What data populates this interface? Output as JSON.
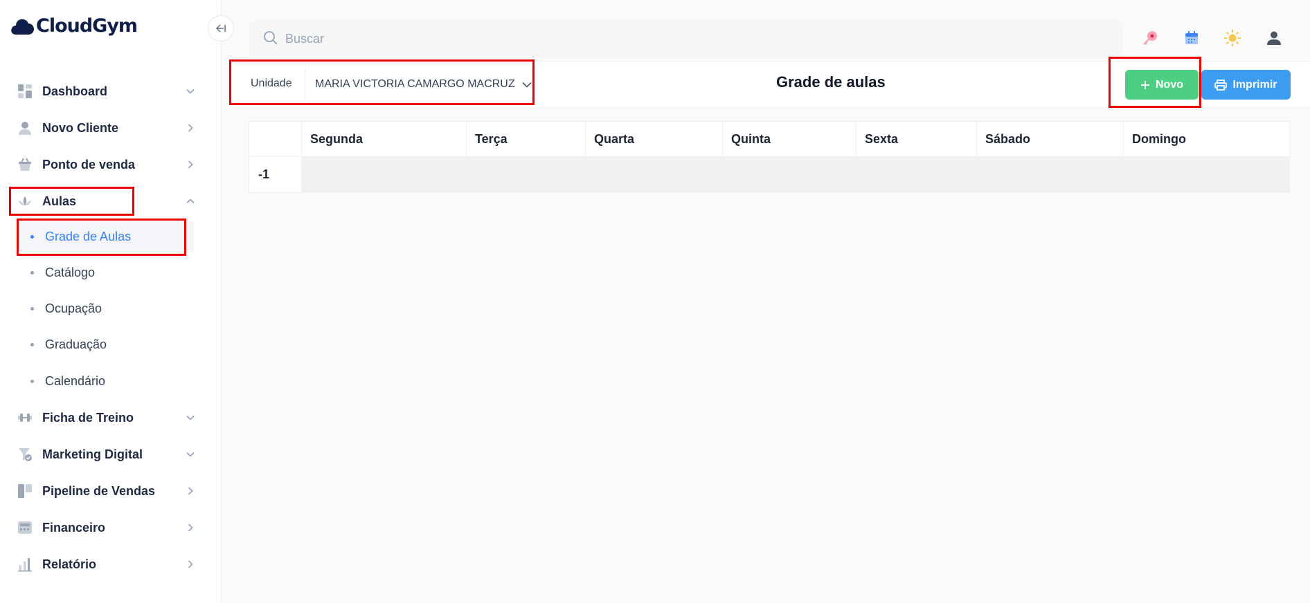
{
  "app": {
    "brand": "CloudGym",
    "brand_part1": "Cloud",
    "brand_part2": "Gym"
  },
  "colors": {
    "accent_blue": "#3b82f6",
    "new_button": "#4ccf80",
    "print_button": "#3b9cf2",
    "highlight": "#ee0000",
    "brand_navy": "#0f1e4a"
  },
  "sidebar": {
    "collapse_icon": "arrow-left-icon",
    "items": [
      {
        "label": "Dashboard",
        "icon": "dashboard-icon",
        "chevron": "chevron-down"
      },
      {
        "label": "Novo Cliente",
        "icon": "user-icon",
        "chevron": "chevron-right"
      },
      {
        "label": "Ponto de venda",
        "icon": "basket-icon",
        "chevron": "chevron-right"
      },
      {
        "label": "Aulas",
        "icon": "lotus-icon",
        "chevron": "chevron-up",
        "expanded": true,
        "children": [
          {
            "label": "Grade de Aulas",
            "active": true
          },
          {
            "label": "Catálogo"
          },
          {
            "label": "Ocupação"
          },
          {
            "label": "Graduação"
          },
          {
            "label": "Calendário"
          }
        ]
      },
      {
        "label": "Ficha de Treino",
        "icon": "dumbbell-icon",
        "chevron": "chevron-down"
      },
      {
        "label": "Marketing Digital",
        "icon": "funnel-icon",
        "chevron": "chevron-down"
      },
      {
        "label": "Pipeline de Vendas",
        "icon": "kanban-icon",
        "chevron": "chevron-right"
      },
      {
        "label": "Financeiro",
        "icon": "wallet-icon",
        "chevron": "chevron-right"
      },
      {
        "label": "Relatório",
        "icon": "bar-chart-icon",
        "chevron": "chevron-right"
      }
    ]
  },
  "header": {
    "search_placeholder": "Buscar",
    "icons": [
      "key-icon",
      "calendar-icon",
      "sun-icon",
      "user-profile-icon"
    ]
  },
  "toolbar": {
    "unit_label": "Unidade",
    "unit_value": "MARIA VICTORIA CAMARGO MACRUZ",
    "title": "Grade de aulas",
    "new_label": "Novo",
    "print_label": "Imprimir"
  },
  "schedule": {
    "columns": [
      "",
      "Segunda",
      "Terça",
      "Quarta",
      "Quinta",
      "Sexta",
      "Sábado",
      "Domingo"
    ],
    "rows": [
      {
        "label": "-1"
      }
    ]
  }
}
